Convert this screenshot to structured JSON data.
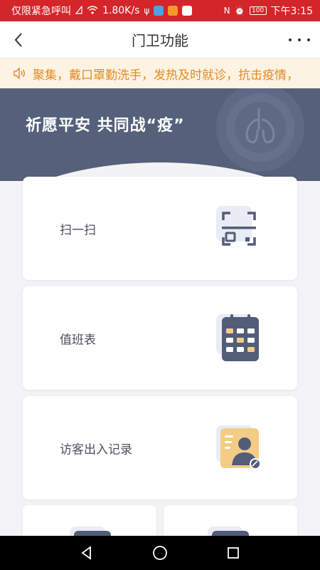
{
  "status_bar": {
    "carrier": "仅限紧急呼叫",
    "speed": "1.80K/s",
    "battery": "100",
    "time": "下午3:15"
  },
  "header": {
    "title": "门卫功能"
  },
  "notice": {
    "text": "聚集，戴口罩勤洗手，发热及时就诊，抗击疫情，"
  },
  "banner": {
    "title": "祈愿平安 共同战“疫”"
  },
  "menu": [
    {
      "label": "扫一扫",
      "icon": "scan-icon"
    },
    {
      "label": "值班表",
      "icon": "calendar-icon"
    },
    {
      "label": "访客出入记录",
      "icon": "visitor-record-icon"
    }
  ],
  "colors": {
    "status_bar": "#d3252a",
    "banner": "#55607a",
    "notice_text": "#e58a1f",
    "notice_bg": "#fdf3e3"
  }
}
